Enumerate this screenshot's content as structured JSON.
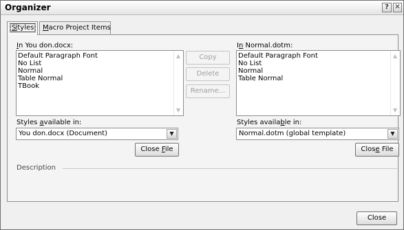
{
  "window": {
    "title": "Organizer",
    "help_glyph": "?",
    "close_glyph": "✕"
  },
  "tabs": [
    {
      "label": "Styles",
      "mnemonic": "S",
      "rest": "tyles",
      "active": true
    },
    {
      "label": "Macro Project Items",
      "mnemonic": "M",
      "rest": "acro Project Items",
      "active": false
    }
  ],
  "left": {
    "list_label_mnemonic": "I",
    "list_label_rest": "n You don.docx:",
    "items": [
      "Default Paragraph Font",
      "No List",
      "Normal",
      "Table Normal",
      "TBook"
    ],
    "available_label_pre": "Styles ",
    "available_label_mnemonic": "a",
    "available_label_post": "vailable in:",
    "available_value": "You don.docx (Document)",
    "close_file_pre": "Close ",
    "close_file_mnemonic": "F",
    "close_file_post": "ile"
  },
  "right": {
    "list_label_pre": "I",
    "list_label_mnemonic": "n",
    "list_label_post": " Normal.dotm:",
    "items": [
      "Default Paragraph Font",
      "No List",
      "Normal",
      "Table Normal"
    ],
    "available_label_pre": "Styles availa",
    "available_label_mnemonic": "b",
    "available_label_post": "le in:",
    "available_value": "Normal.dotm (global template)",
    "close_file_pre": "Clos",
    "close_file_mnemonic": "e",
    "close_file_post": " File"
  },
  "middle": {
    "copy_label": "Copy",
    "delete_label": "Delete",
    "rename_label": "Rename..."
  },
  "description": {
    "label": "Description"
  },
  "footer": {
    "close_label": "Close"
  },
  "icons": {
    "dropdown": "chevron-down-icon",
    "scroll_up": "scroll-up-icon",
    "scroll_down": "scroll-down-icon"
  }
}
